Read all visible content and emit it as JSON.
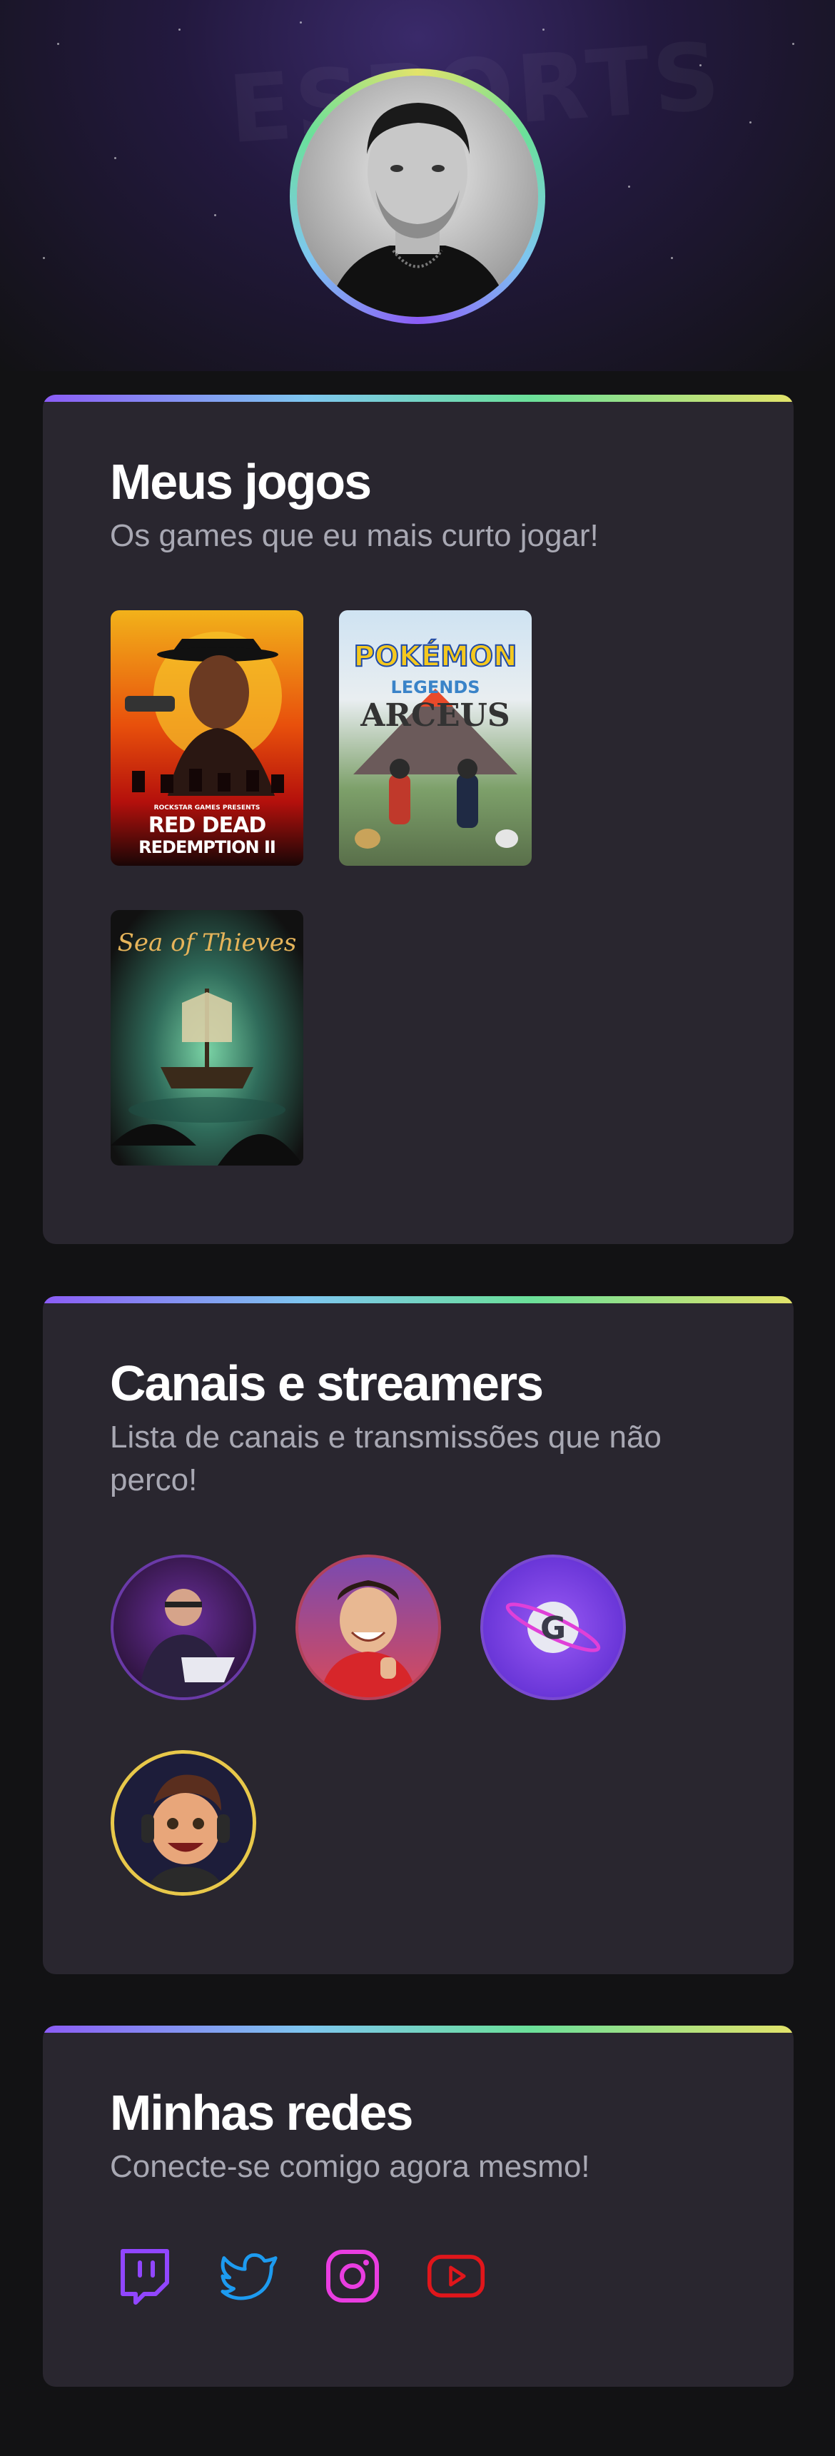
{
  "profile": {
    "avatar_icon": "profile-photo",
    "ring_colors": [
      "#e3e36a",
      "#6be09a",
      "#7ec6f0",
      "#8b5cf6"
    ]
  },
  "games_section": {
    "title": "Meus jogos",
    "subtitle": "Os games que eu mais curto jogar!",
    "games": [
      {
        "name": "Red Dead Redemption II",
        "line1": "RED DEAD",
        "line2": "REDEMPTION II",
        "publisher": "ROCKSTAR GAMES PRESENTS"
      },
      {
        "name": "Pokémon Legends Arceus",
        "line1": "POKÉMON",
        "line2": "LEGENDS",
        "line3": "ARCEUS"
      },
      {
        "name": "Sea of Thieves",
        "line1": "Sea of Thieves"
      }
    ]
  },
  "channels_section": {
    "title": "Canais e streamers",
    "subtitle": "Lista de canais e transmissões que não perco!",
    "channels": [
      {
        "avatar": "streamer-1-avatar"
      },
      {
        "avatar": "streamer-2-avatar"
      },
      {
        "avatar": "streamer-3-logo",
        "letter": "G"
      },
      {
        "avatar": "streamer-4-cartoon-avatar"
      }
    ]
  },
  "social_section": {
    "title": "Minhas redes",
    "subtitle": "Conecte-se comigo agora mesmo!",
    "links": [
      {
        "icon": "twitch-icon",
        "color": "#9146ff"
      },
      {
        "icon": "twitter-icon",
        "color": "#1d9bf0"
      },
      {
        "icon": "instagram-icon",
        "color": "#e93de0"
      },
      {
        "icon": "youtube-icon",
        "color": "#e0161b"
      }
    ]
  },
  "colors": {
    "background": "#121214",
    "card": "#29262f",
    "subtitle": "#a8a8b3"
  }
}
